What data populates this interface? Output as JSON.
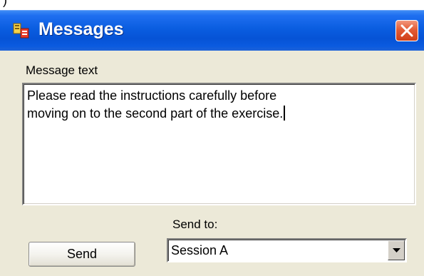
{
  "window": {
    "title": "Messages",
    "icon": "messages-app-icon"
  },
  "message_group": {
    "label": "Message text",
    "lines": [
      "Please read the instructions carefully before",
      "moving on to the second part of the exercise."
    ]
  },
  "send_button": {
    "label": "Send"
  },
  "send_to": {
    "label": "Send to:",
    "selected": "Session A",
    "dropdown_icon": "chevron-down-icon"
  },
  "colors": {
    "titlebar": "#0653d6",
    "close_button": "#e35c36",
    "window_background": "#ece9d8"
  }
}
